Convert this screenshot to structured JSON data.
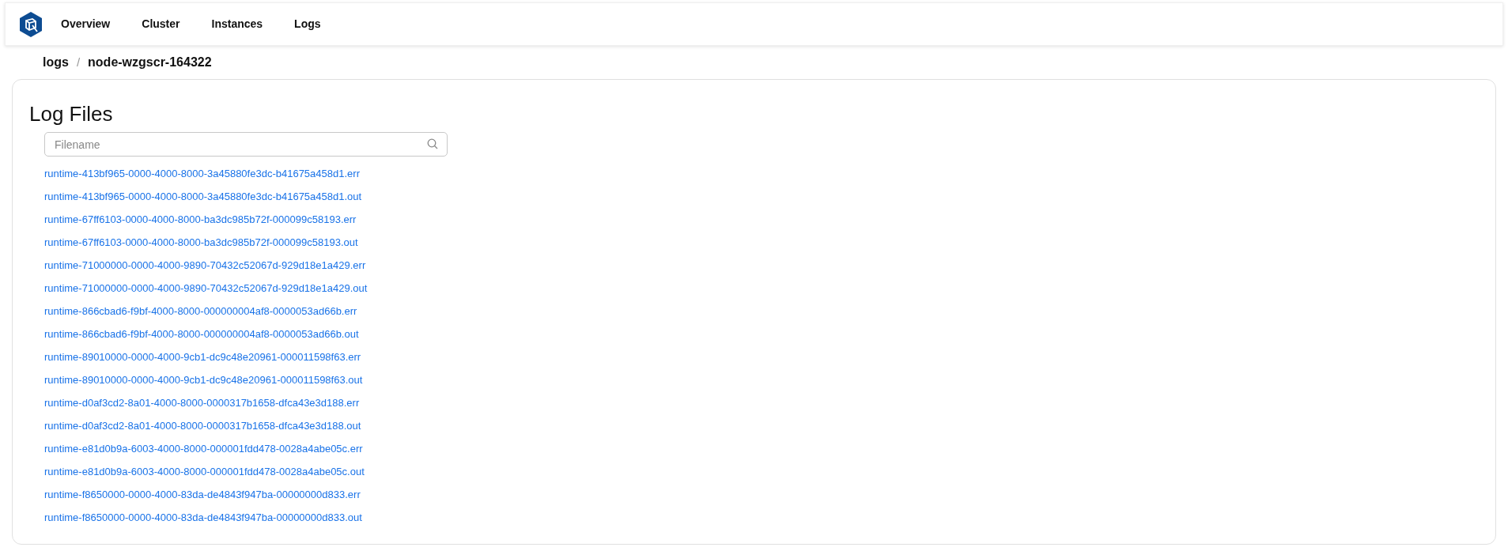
{
  "nav": {
    "items": [
      "Overview",
      "Cluster",
      "Instances",
      "Logs"
    ]
  },
  "breadcrumb": [
    "logs",
    "/",
    "node-wzgscr-164322"
  ],
  "card": {
    "title": "Log Files",
    "search": {
      "placeholder": "Filename"
    },
    "files": [
      "runtime-413bf965-0000-4000-8000-3a45880fe3dc-b41675a458d1.err",
      "runtime-413bf965-0000-4000-8000-3a45880fe3dc-b41675a458d1.out",
      "runtime-67ff6103-0000-4000-8000-ba3dc985b72f-000099c58193.err",
      "runtime-67ff6103-0000-4000-8000-ba3dc985b72f-000099c58193.out",
      "runtime-71000000-0000-4000-9890-70432c52067d-929d18e1a429.err",
      "runtime-71000000-0000-4000-9890-70432c52067d-929d18e1a429.out",
      "runtime-866cbad6-f9bf-4000-8000-000000004af8-0000053ad66b.err",
      "runtime-866cbad6-f9bf-4000-8000-000000004af8-0000053ad66b.out",
      "runtime-89010000-0000-4000-9cb1-dc9c48e20961-000011598f63.err",
      "runtime-89010000-0000-4000-9cb1-dc9c48e20961-000011598f63.out",
      "runtime-d0af3cd2-8a01-4000-8000-0000317b1658-dfca43e3d188.err",
      "runtime-d0af3cd2-8a01-4000-8000-0000317b1658-dfca43e3d188.out",
      "runtime-e81d0b9a-6003-4000-8000-000001fdd478-0028a4abe05c.err",
      "runtime-e81d0b9a-6003-4000-8000-000001fdd478-0028a4abe05c.out",
      "runtime-f8650000-0000-4000-83da-de4843f947ba-00000000d833.err",
      "runtime-f8650000-0000-4000-83da-de4843f947ba-00000000d833.out"
    ]
  }
}
